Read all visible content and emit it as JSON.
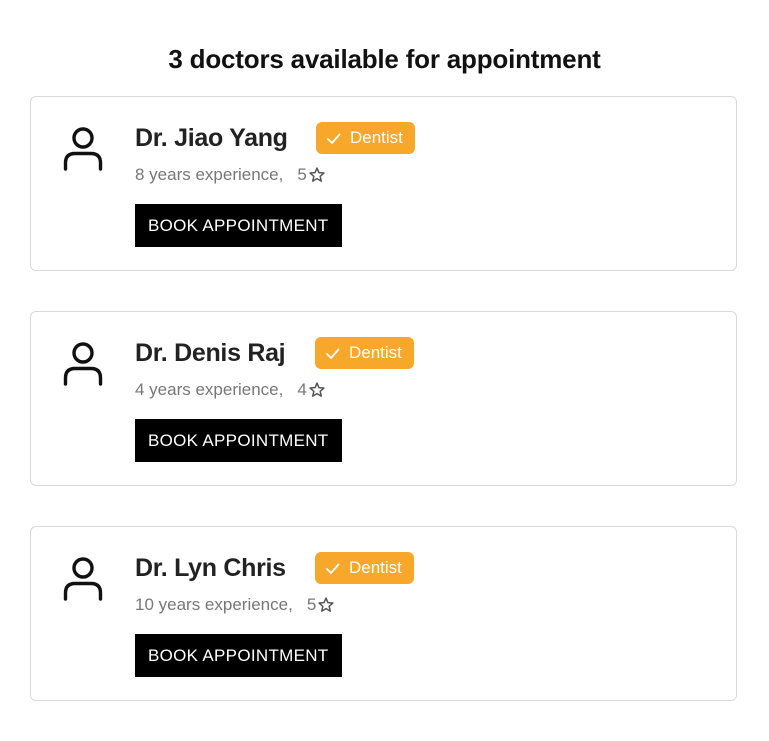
{
  "page": {
    "title": "3 doctors available for appointment"
  },
  "theme": {
    "badge_color": "#f7a82a",
    "button_color": "#000000",
    "border_color": "#d9d9d9"
  },
  "doctors": [
    {
      "name": "Dr. Jiao Yang",
      "specialty": "Dentist",
      "experience": "8 years experience,",
      "rating": "5",
      "book_label": "BOOK APPOINTMENT",
      "avatar_icon": "user-icon",
      "badge_icon": "check-icon",
      "rating_icon": "star-icon"
    },
    {
      "name": "Dr. Denis Raj",
      "specialty": "Dentist",
      "experience": "4 years experience,",
      "rating": "4",
      "book_label": "BOOK APPOINTMENT",
      "avatar_icon": "user-icon",
      "badge_icon": "check-icon",
      "rating_icon": "star-icon"
    },
    {
      "name": "Dr. Lyn Chris",
      "specialty": "Dentist",
      "experience": "10 years experience,",
      "rating": "5",
      "book_label": "BOOK APPOINTMENT",
      "avatar_icon": "user-icon",
      "badge_icon": "check-icon",
      "rating_icon": "star-icon"
    }
  ]
}
